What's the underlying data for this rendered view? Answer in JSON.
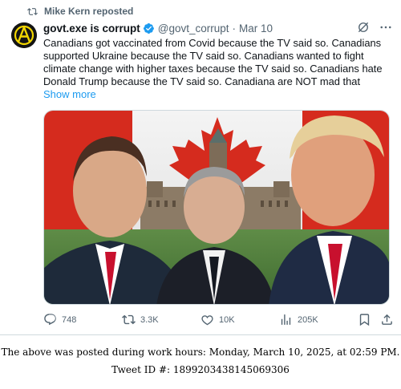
{
  "repost": {
    "text": "Mike Kern reposted"
  },
  "author": {
    "name": "govt.exe is corrupt",
    "handle": "@govt_corrupt",
    "separator": "·",
    "date": "Mar 10"
  },
  "tweet": {
    "text": "Canadians got vaccinated from Covid because the TV said so. Canadians supported Ukraine because the TV said so. Canadians wanted to fight climate change with higher taxes because the TV said so. Canadians hate Donald Trump because the TV said so. Canadiana are NOT mad that",
    "show_more": "Show more"
  },
  "media": {
    "description_icon": "photo-of-three-politicians"
  },
  "actions": {
    "replies": "748",
    "reposts": "3.3K",
    "likes": "10K",
    "views": "205K"
  },
  "footer": {
    "line1": "The above was posted during work hours: Monday, March 10, 2025, at 02:59 PM.",
    "line2": "Tweet ID #: 1899203438145069306"
  },
  "colors": {
    "accent": "#1d9bf0",
    "muted": "#536471",
    "text": "#0f1419",
    "flag_red": "#d52b1e"
  }
}
